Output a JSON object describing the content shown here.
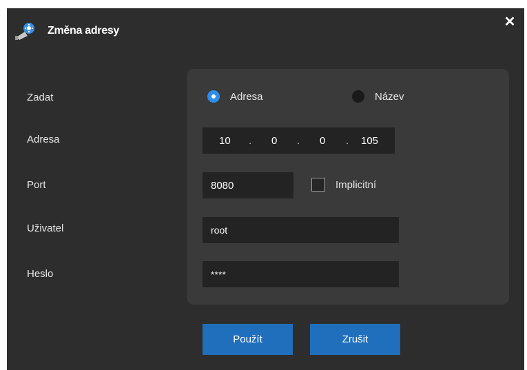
{
  "window": {
    "title": "Změna adresy",
    "close_glyph": "✕",
    "icon": "camera-gear-icon"
  },
  "form": {
    "labels": {
      "mode": "Zadat",
      "address": "Adresa",
      "port": "Port",
      "user": "Uživatel",
      "password": "Heslo"
    },
    "mode_options": [
      {
        "label": "Adresa",
        "selected": true
      },
      {
        "label": "Název",
        "selected": false
      }
    ],
    "ip": {
      "octets": [
        "10",
        "0",
        "0",
        "105"
      ],
      "separator": "."
    },
    "port": {
      "value": "8080",
      "default_label": "Implicitní",
      "default_checked": false
    },
    "user": {
      "value": "root"
    },
    "password": {
      "value": "****"
    }
  },
  "buttons": {
    "apply": "Použít",
    "cancel": "Zrušit"
  },
  "colors": {
    "background": "#2d2d2d",
    "panel": "#3a3a3a",
    "field": "#232323",
    "accent": "#2e8ee8",
    "button": "#1f6fbd"
  }
}
